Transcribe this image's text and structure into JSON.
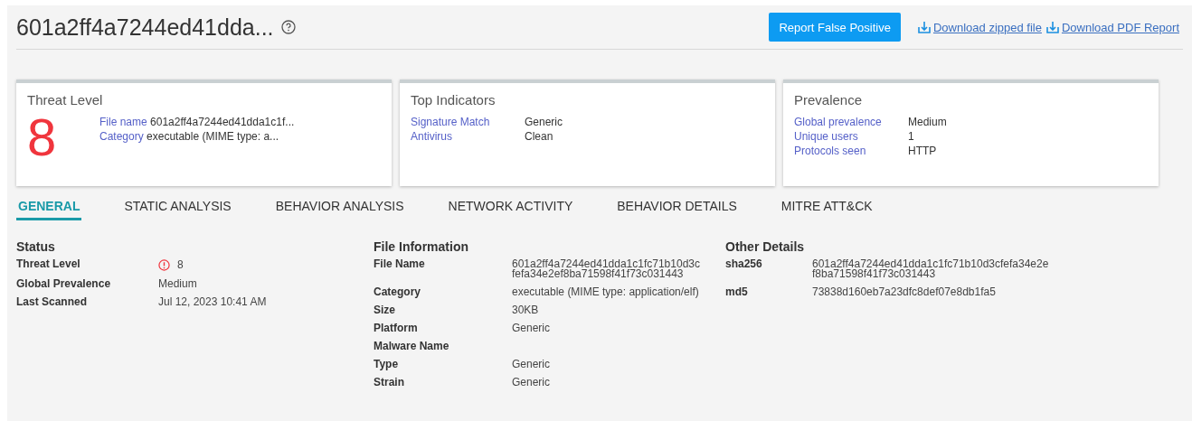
{
  "header": {
    "title": "601a2ff4a7244ed41dda...",
    "report_button": "Report False Positive",
    "links": [
      "Download zipped file",
      "Download PDF Report"
    ]
  },
  "cards": [
    {
      "kind": "threat",
      "title": "Threat Level",
      "score": "8",
      "rows": [
        {
          "label": "File name",
          "value": "601a2ff4a7244ed41dda1c1f..."
        },
        {
          "label": "Category",
          "value": "executable (MIME type: a..."
        }
      ]
    },
    {
      "kind": "table",
      "title": "Top Indicators",
      "rows": [
        {
          "label": "Signature Match",
          "value": "Generic"
        },
        {
          "label": "Antivirus",
          "value": "Clean"
        }
      ]
    },
    {
      "kind": "table",
      "title": "Prevalence",
      "rows": [
        {
          "label": "Global prevalence",
          "value": "Medium"
        },
        {
          "label": "Unique users",
          "value": "1"
        },
        {
          "label": "Protocols seen",
          "value": "HTTP"
        }
      ]
    }
  ],
  "tabs": [
    {
      "label": "GENERAL",
      "selected": true
    },
    {
      "label": "STATIC ANALYSIS",
      "selected": false
    },
    {
      "label": "BEHAVIOR ANALYSIS",
      "selected": false
    },
    {
      "label": "NETWORK ACTIVITY",
      "selected": false
    },
    {
      "label": "BEHAVIOR DETAILS",
      "selected": false
    },
    {
      "label": "MITRE ATT&CK",
      "selected": false
    }
  ],
  "sections": [
    {
      "title": "Status",
      "rows": [
        {
          "label": "Threat Level",
          "value": [
            "8"
          ],
          "alert": true
        },
        {
          "label": "Global Prevalence",
          "value": [
            "Medium"
          ]
        },
        {
          "label": "Last Scanned",
          "value": [
            "Jul 12, 2023 10:41 AM"
          ]
        }
      ]
    },
    {
      "title": "File Information",
      "rows": [
        {
          "label": "File Name",
          "value": [
            "601a2ff4a7244ed41dda1c1fc71b10d3c",
            "fefa34e2ef8ba71598f41f73c031443"
          ]
        },
        {
          "label": "Category",
          "value": [
            "executable (MIME type: application/elf)"
          ]
        },
        {
          "label": "Size",
          "value": [
            "30KB"
          ]
        },
        {
          "label": "Platform",
          "value": [
            "Generic"
          ]
        },
        {
          "label": "Malware Name",
          "value": []
        },
        {
          "label": "Type",
          "value": [
            "Generic"
          ]
        },
        {
          "label": "Strain",
          "value": [
            "Generic"
          ]
        }
      ]
    },
    {
      "title": "Other Details",
      "rows": [
        {
          "label": "sha256",
          "value": [
            "601a2ff4a7244ed41dda1c1fc71b10d3cfefa34e2e",
            "f8ba71598f41f73c031443"
          ]
        },
        {
          "label": "md5",
          "value": [
            "73838d160eb7a23dfc8def07e8db1fa5"
          ]
        }
      ]
    }
  ]
}
